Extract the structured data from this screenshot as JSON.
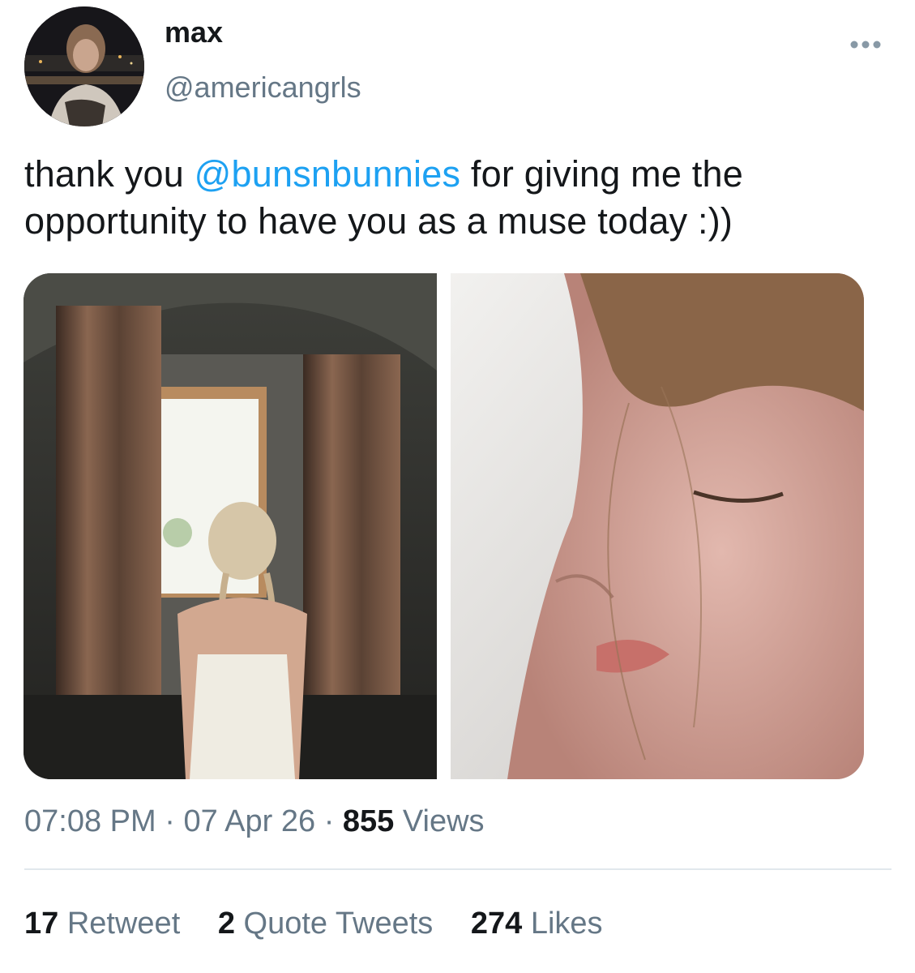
{
  "author": {
    "name": "max",
    "handle": "@americangrls"
  },
  "tweet": {
    "text_before": "thank you ",
    "mention": "@bunsnbunnies",
    "text_after": " for giving me the opportunity to have you as a muse today :))"
  },
  "meta": {
    "time": "07:08 PM",
    "separator": "·",
    "date": "07 Apr 26",
    "views_count": "855",
    "views_label": "Views"
  },
  "stats": {
    "retweets_count": "17",
    "retweets_label": "Retweet",
    "quotes_count": "2",
    "quotes_label": "Quote Tweets",
    "likes_count": "274",
    "likes_label": "Likes"
  },
  "icons": {
    "more": "more-horizontal-icon"
  },
  "colors": {
    "mention": "#1da1f2",
    "secondary_text": "#657786",
    "primary_text": "#14171a",
    "divider": "#e1e8ed"
  }
}
